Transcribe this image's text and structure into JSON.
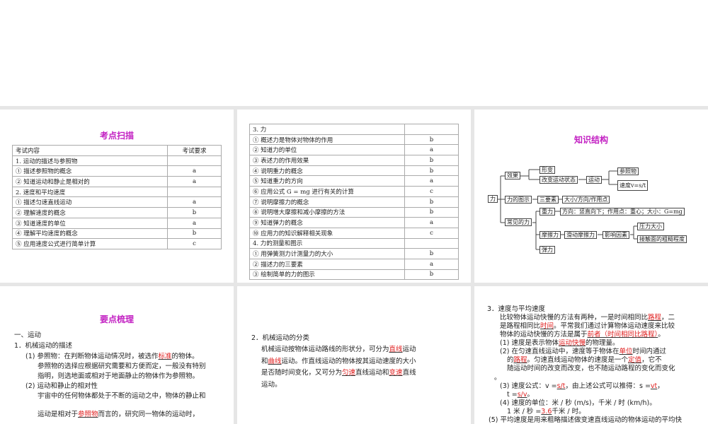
{
  "slide1": {
    "title": "考点扫描",
    "header": [
      "考试内容",
      "考试要求"
    ],
    "rows": [
      [
        "1. 运动的描述与参照物",
        ""
      ],
      [
        "① 描述参照物的概念",
        "a"
      ],
      [
        "② 知道运动和静止是相对的",
        "a"
      ],
      [
        "2. 速度和平均速度",
        ""
      ],
      [
        "① 描述匀速直线运动",
        "a"
      ],
      [
        "② 理解速度的概念",
        "b"
      ],
      [
        "③ 知道速度的单位",
        "a"
      ],
      [
        "④ 理解平均速度的概念",
        "b"
      ],
      [
        "⑤ 应用速度公式进行简单计算",
        "c"
      ]
    ]
  },
  "slide2": {
    "rows": [
      [
        "3. 力",
        ""
      ],
      [
        "① 概述力是物体对物体的作用",
        "b"
      ],
      [
        "② 知道力的单位",
        "a"
      ],
      [
        "③ 表述力的作用效果",
        "b"
      ],
      [
        "④ 说明重力的概念",
        "b"
      ],
      [
        "⑤ 知道重力的方向",
        "a"
      ],
      [
        "⑥ 应用公式 G = mg 进行有关的计算",
        "c"
      ],
      [
        "⑦ 说明摩擦力的概念",
        "b"
      ],
      [
        "⑧ 说明增大摩擦和减小摩擦的方法",
        "b"
      ],
      [
        "⑨ 知道弹力的概念",
        "a"
      ],
      [
        "⑩ 应用力的知识解释相关现象",
        "c"
      ],
      [
        "4. 力的测量和图示",
        ""
      ],
      [
        "① 用弹簧测力计测量力的大小",
        "b"
      ],
      [
        "② 描述力的三要素",
        "a"
      ],
      [
        "③ 绘制简单的力的图示",
        "b"
      ]
    ]
  },
  "slide3": {
    "title": "知识结构",
    "nodes": {
      "li": "力",
      "xiaoguo": "效果",
      "xingbian": "形变",
      "gaibian": "改变运动状态",
      "yundong": "运动",
      "canzhao": "参照物",
      "sudu": "速度v=s/t",
      "tushi": "力的图示",
      "sanyaosu": "三要素",
      "daxiao": "大小/方向/作用点",
      "changjian": "常见的力",
      "zhongli": "重力",
      "zhongli_desc": "方向：竖直向下；作用点：重心；大小：G=mg",
      "moca": "摩擦力",
      "huadong": "滑动摩擦力",
      "yingxiang": "影响因素",
      "yali": "压力大小",
      "jiechu": "接触面的粗糙程度",
      "tanli": "弹力"
    }
  },
  "slide4": {
    "title": "要点梳理",
    "lines": [
      [
        {
          "t": "一、运动"
        }
      ],
      [
        {
          "t": "1．机械运动的描述"
        }
      ],
      [
        {
          "t": "(1) 参照物：在判断物体运动情况时，被选作"
        },
        {
          "t": "标准",
          "a": 1
        },
        {
          "t": "的物体。"
        }
      ],
      [
        {
          "t": "参照物的选择应根据研究需要和方便而定，一般没有特别"
        }
      ],
      [
        {
          "t": "指明，则选地面或相对于地面静止的物体作为参照物。"
        }
      ],
      [
        {
          "t": "(2) 运动和静止的相对性"
        }
      ],
      [
        {
          "t": "宇宙中的任何物体都处于不断的运动之中，物体的静止和"
        }
      ],
      [
        {
          "t": "运动是相对于"
        },
        {
          "t": "参照物",
          "a": 1
        },
        {
          "t": "而言的，研究同一物体的运动时，"
        }
      ]
    ]
  },
  "slide5": {
    "lines": [
      [
        {
          "t": "2．机械运动的分类"
        }
      ],
      [
        {
          "t": "机械运动按物体运动路线的形状分，可分为"
        },
        {
          "t": "直线",
          "a": 1
        },
        {
          "t": "运动"
        }
      ],
      [
        {
          "t": "和"
        },
        {
          "t": "曲线",
          "a": 1
        },
        {
          "t": "运动。作直线运动的物体按其运动速度的大小"
        }
      ],
      [
        {
          "t": "是否随时间变化，又可分为"
        },
        {
          "t": "匀速",
          "a": 1
        },
        {
          "t": "直线运动和"
        },
        {
          "t": "变速",
          "a": 1
        },
        {
          "t": "直线"
        }
      ],
      [
        {
          "t": "运动。"
        }
      ]
    ]
  },
  "slide6": {
    "lines": [
      [
        {
          "t": "3．速度与平均速度"
        }
      ],
      [
        {
          "t": "比较物体运动快慢的方法有两种，一是时间相同比"
        },
        {
          "t": "路程",
          "a": 1
        },
        {
          "t": "，二"
        }
      ],
      [
        {
          "t": "是路程相同比"
        },
        {
          "t": "时间",
          "a": 1
        },
        {
          "t": "。平常我们通过计算物体运动速度来比较"
        }
      ],
      [
        {
          "t": "物体的运动快慢的方法是属于"
        },
        {
          "t": "前者（时间相同比路程）",
          "a": 1
        },
        {
          "t": "。"
        }
      ],
      [
        {
          "t": "(1) 速度是表示物体"
        },
        {
          "t": "运动快慢",
          "a": 1
        },
        {
          "t": "的物理量。"
        }
      ],
      [
        {
          "t": "(2) 在匀速直线运动中，速度等于物体在"
        },
        {
          "t": "单位",
          "a": 1
        },
        {
          "t": "时间内通过"
        }
      ],
      [
        {
          "t": "的"
        },
        {
          "t": "路程",
          "a": 1
        },
        {
          "t": "。匀速直线运动物体的速度是一个"
        },
        {
          "t": "定值",
          "a": 1
        },
        {
          "t": "，它不"
        }
      ],
      [
        {
          "t": "随运动时间的改变而改变，也不随运动路程的变化而变化"
        }
      ],
      [
        {
          "t": "。"
        }
      ],
      [
        {
          "t": "(3) 速度公式：v ="
        },
        {
          "t": "s/t",
          "a": 1
        },
        {
          "t": "，由上述公式可以推得：s ="
        },
        {
          "t": "vt",
          "a": 1
        },
        {
          "t": "，"
        }
      ],
      [
        {
          "t": "t ="
        },
        {
          "t": "s/v",
          "a": 1
        },
        {
          "t": "。"
        }
      ],
      [
        {
          "t": "(4) 速度的单位：米 / 秒 (m/s)，千米 / 时 (km/h)。"
        }
      ],
      [
        {
          "t": "1 米 / 秒 ="
        },
        {
          "t": "3.6",
          "a": 1
        },
        {
          "t": "千米 / 时。"
        }
      ],
      [
        {
          "t": "(5) 平均速度是用来粗略描述做变速直线运动的物体运动的平均快"
        }
      ]
    ]
  }
}
